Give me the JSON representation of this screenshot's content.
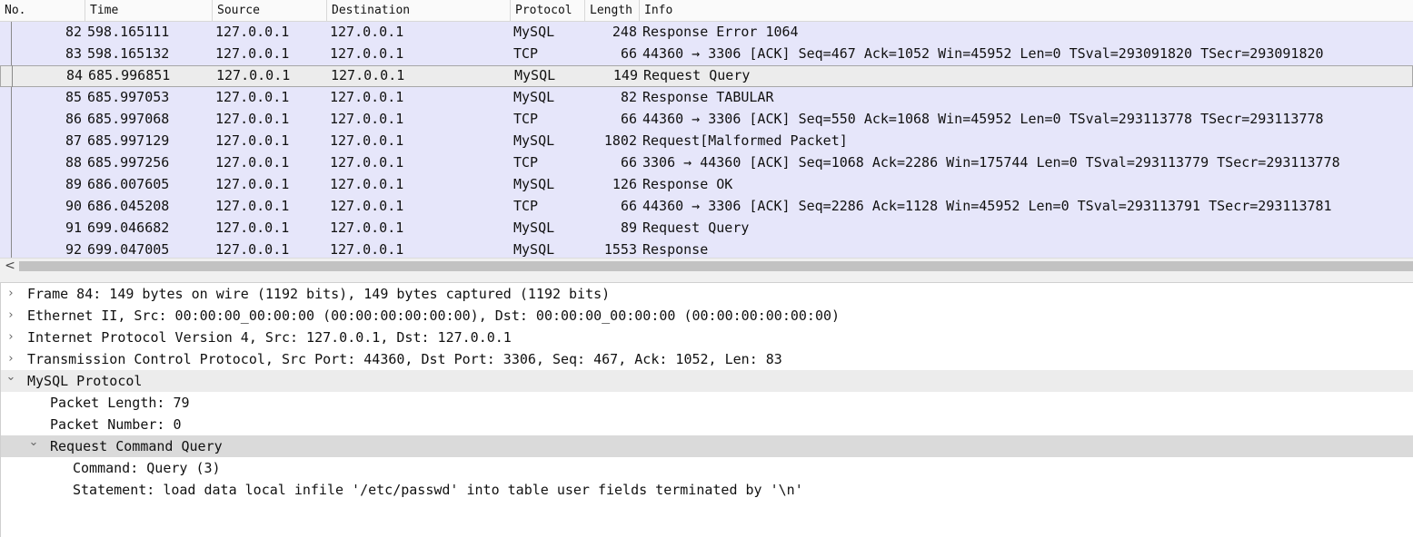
{
  "columns": [
    "No.",
    "Time",
    "Source",
    "Destination",
    "Protocol",
    "Length",
    "Info"
  ],
  "packets": [
    {
      "no": "82",
      "time": "598.165111",
      "src": "127.0.0.1",
      "dst": "127.0.0.1",
      "proto": "MySQL",
      "len": "248",
      "info": "Response Error 1064"
    },
    {
      "no": "83",
      "time": "598.165132",
      "src": "127.0.0.1",
      "dst": "127.0.0.1",
      "proto": "TCP",
      "len": "66",
      "info": "44360 → 3306 [ACK] Seq=467 Ack=1052 Win=45952 Len=0 TSval=293091820 TSecr=293091820"
    },
    {
      "no": "84",
      "time": "685.996851",
      "src": "127.0.0.1",
      "dst": "127.0.0.1",
      "proto": "MySQL",
      "len": "149",
      "info": "Request Query"
    },
    {
      "no": "85",
      "time": "685.997053",
      "src": "127.0.0.1",
      "dst": "127.0.0.1",
      "proto": "MySQL",
      "len": "82",
      "info": "Response TABULAR"
    },
    {
      "no": "86",
      "time": "685.997068",
      "src": "127.0.0.1",
      "dst": "127.0.0.1",
      "proto": "TCP",
      "len": "66",
      "info": "44360 → 3306 [ACK] Seq=550 Ack=1068 Win=45952 Len=0 TSval=293113778 TSecr=293113778"
    },
    {
      "no": "87",
      "time": "685.997129",
      "src": "127.0.0.1",
      "dst": "127.0.0.1",
      "proto": "MySQL",
      "len": "1802",
      "info": "Request[Malformed Packet]"
    },
    {
      "no": "88",
      "time": "685.997256",
      "src": "127.0.0.1",
      "dst": "127.0.0.1",
      "proto": "TCP",
      "len": "66",
      "info": "3306 → 44360 [ACK] Seq=1068 Ack=2286 Win=175744 Len=0 TSval=293113779 TSecr=293113778"
    },
    {
      "no": "89",
      "time": "686.007605",
      "src": "127.0.0.1",
      "dst": "127.0.0.1",
      "proto": "MySQL",
      "len": "126",
      "info": "Response OK"
    },
    {
      "no": "90",
      "time": "686.045208",
      "src": "127.0.0.1",
      "dst": "127.0.0.1",
      "proto": "TCP",
      "len": "66",
      "info": "44360 → 3306 [ACK] Seq=2286 Ack=1128 Win=45952 Len=0 TSval=293113791 TSecr=293113781"
    },
    {
      "no": "91",
      "time": "699.046682",
      "src": "127.0.0.1",
      "dst": "127.0.0.1",
      "proto": "MySQL",
      "len": "89",
      "info": "Request Query"
    },
    {
      "no": "92",
      "time": "699.047005",
      "src": "127.0.0.1",
      "dst": "127.0.0.1",
      "proto": "MySQL",
      "len": "1553",
      "info": "Response"
    }
  ],
  "selected_packet": "84",
  "scroll_left_arrow": "<",
  "details": [
    {
      "depth": 0,
      "expanded": false,
      "highlight": "",
      "text": "Frame 84: 149 bytes on wire (1192 bits), 149 bytes captured (1192 bits)"
    },
    {
      "depth": 0,
      "expanded": false,
      "highlight": "",
      "text": "Ethernet II, Src: 00:00:00_00:00:00 (00:00:00:00:00:00), Dst: 00:00:00_00:00:00 (00:00:00:00:00:00)"
    },
    {
      "depth": 0,
      "expanded": false,
      "highlight": "",
      "text": "Internet Protocol Version 4, Src: 127.0.0.1, Dst: 127.0.0.1"
    },
    {
      "depth": 0,
      "expanded": false,
      "highlight": "",
      "text": "Transmission Control Protocol, Src Port: 44360, Dst Port: 3306, Seq: 467, Ack: 1052, Len: 83"
    },
    {
      "depth": 0,
      "expanded": true,
      "highlight": "light",
      "text": "MySQL Protocol"
    },
    {
      "depth": 1,
      "leaf": true,
      "highlight": "",
      "text": "Packet Length: 79"
    },
    {
      "depth": 1,
      "leaf": true,
      "highlight": "",
      "text": "Packet Number: 0"
    },
    {
      "depth": 1,
      "expanded": true,
      "highlight": "dark",
      "text": "Request Command Query"
    },
    {
      "depth": 2,
      "leaf": true,
      "highlight": "",
      "text": "Command: Query (3)"
    },
    {
      "depth": 2,
      "leaf": true,
      "highlight": "",
      "text": "Statement: load data local infile '/etc/passwd' into table user fields terminated by '\\n'"
    }
  ]
}
